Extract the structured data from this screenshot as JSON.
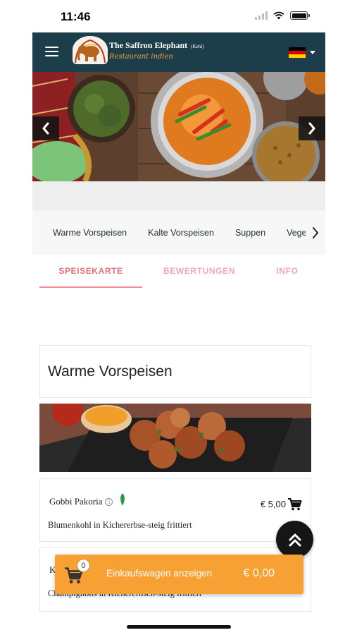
{
  "status_bar": {
    "time": "11:46"
  },
  "header": {
    "restaurant_name": "The Saffron Elephant",
    "restaurant_location": "(Kehl)",
    "restaurant_subtitle": "Restaurant indien",
    "language_flag": "germany-flag"
  },
  "categories": [
    "Warme Vorspeisen",
    "Kalte Vorspeisen",
    "Suppen",
    "Vegetarisch"
  ],
  "tabs": [
    {
      "label": "SPEISEKARTE",
      "active": true
    },
    {
      "label": "BEWERTUNGEN",
      "active": false
    },
    {
      "label": "INFO",
      "active": false
    }
  ],
  "menu_section": {
    "title": "Warme Vorspeisen"
  },
  "items": [
    {
      "name": "Gobbi Pakoria",
      "price": "€ 5,00",
      "description": "Blumenkohl in Kichererbse-steig frittiert",
      "vegetarian": true
    },
    {
      "name_initial": "K",
      "description": "Champignons in Kichererbsen-steig frittiert"
    }
  ],
  "cart": {
    "count": "0",
    "label": "Einkaufswagen anzeigen",
    "total": "€ 0,00"
  },
  "colors": {
    "header_bg": "#1c3d4a",
    "accent_tab": "#e2707f",
    "cart_bar": "#f7a134",
    "leaf_green": "#2ea44f"
  }
}
